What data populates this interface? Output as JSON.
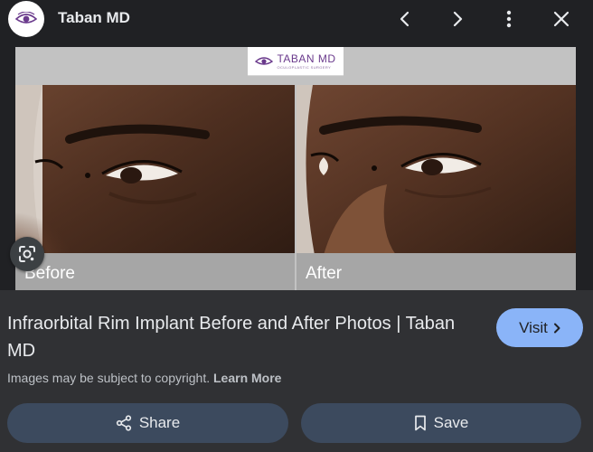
{
  "header": {
    "site_name": "Taban MD",
    "icons": {
      "logo": "eye-logo-icon",
      "prev": "chevron-left-icon",
      "next": "chevron-right-icon",
      "menu": "more-vertical-icon",
      "close": "close-icon"
    }
  },
  "image": {
    "banner_title": "TABAN MD",
    "banner_subtitle": "OCULOPLASTIC SURGERY",
    "before_label": "Before",
    "after_label": "After",
    "lens_icon": "google-lens-icon"
  },
  "result": {
    "title": "Infraorbital Rim Implant Before and After Photos | Taban MD",
    "visit_label": "Visit",
    "copyright_text": "Images may be subject to copyright.",
    "learn_more": "Learn More",
    "share_label": "Share",
    "save_label": "Save"
  },
  "colors": {
    "background": "#202124",
    "panel": "#303134",
    "visit_button": "#8ab4f8",
    "action_button": "#3c4a5e",
    "brand_purple": "#6a3a8c"
  }
}
